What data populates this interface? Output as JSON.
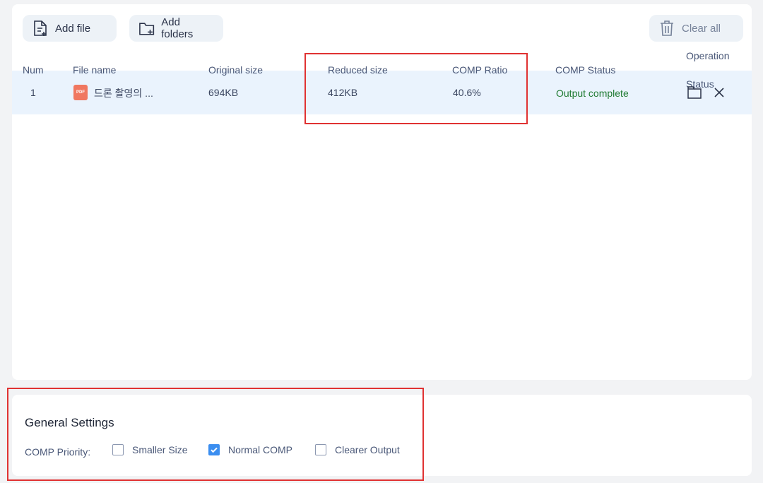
{
  "toolbar": {
    "add_file": "Add file",
    "add_folders": "Add folders",
    "clear_all": "Clear all"
  },
  "table": {
    "headers": {
      "num": "Num",
      "file_name": "File name",
      "original_size": "Original size",
      "reduced_size": "Reduced size",
      "comp_ratio": "COMP Ratio",
      "comp_status": "COMP Status",
      "operation": "Operation",
      "status": "Status"
    },
    "rows": [
      {
        "num": "1",
        "file_icon": "PDF",
        "file_name": "드론 촬영의 ...",
        "original_size": "694KB",
        "reduced_size": "412KB",
        "comp_ratio": "40.6%",
        "comp_status": "Output complete"
      }
    ]
  },
  "settings": {
    "title": "General Settings",
    "priority_label": "COMP Priority:",
    "options": [
      {
        "label": "Smaller Size",
        "checked": false
      },
      {
        "label": "Normal COMP",
        "checked": true
      },
      {
        "label": "Clearer Output",
        "checked": false
      }
    ]
  },
  "colors": {
    "accent": "#3b8ef0",
    "row_highlight": "#eaf3fd",
    "status_complete": "#1f7a31",
    "annotation_red": "#e03232"
  },
  "icons": {
    "add_file": "file-plus-icon",
    "add_folders": "folder-plus-icon",
    "clear_all": "trash-icon",
    "open_folder": "folder-icon",
    "remove": "close-icon",
    "file_type": "pdf-icon",
    "check": "check-icon"
  }
}
